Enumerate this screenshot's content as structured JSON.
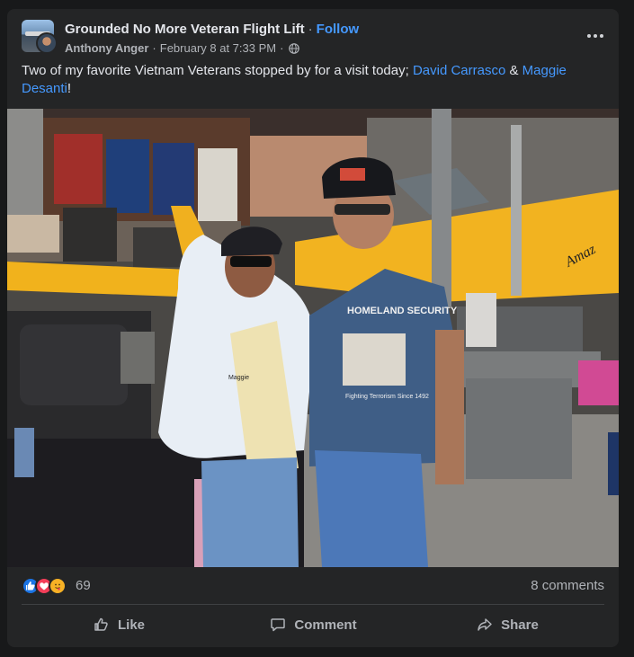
{
  "post": {
    "group_name": "Grounded No More Veteran Flight Lift",
    "separator": "·",
    "follow_label": "Follow",
    "author": "Anthony Anger",
    "timestamp": "February 8 at 7:33 PM",
    "audience_icon": "globe-icon",
    "more_icon": "more-options-icon",
    "text_before": "Two of my favorite Vietnam Veterans stopped by for a visit today; ",
    "tag_1": "David Carrasco",
    "text_between": " & ",
    "tag_2": "Maggie Desanti",
    "text_after": "!"
  },
  "photo": {
    "jacket_name": "Maggie",
    "shirt_text": "HOMELAND SECURITY",
    "shirt_subtext": "Fighting Terrorism Since 1492",
    "plane_text": "Amaz"
  },
  "engagement": {
    "reaction_icons": [
      "like-reaction-icon",
      "love-reaction-icon",
      "care-reaction-icon"
    ],
    "reaction_count": "69",
    "comments": "8 comments"
  },
  "actions": {
    "like": "Like",
    "comment": "Comment",
    "share": "Share"
  },
  "colors": {
    "background": "#18191a",
    "card": "#242526",
    "link": "#4599ff",
    "muted_text": "#b0b3b8",
    "primary_text": "#e4e6eb"
  }
}
